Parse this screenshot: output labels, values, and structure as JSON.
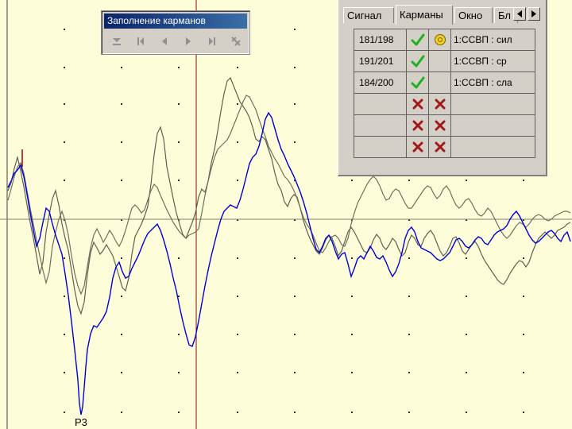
{
  "toolbar": {
    "title": "Заполнение карманов",
    "buttons": [
      {
        "name": "download-icon"
      },
      {
        "name": "first-icon"
      },
      {
        "name": "prev-icon"
      },
      {
        "name": "next-icon"
      },
      {
        "name": "last-icon"
      },
      {
        "name": "auto-fill-icon"
      }
    ]
  },
  "panel": {
    "tabs": [
      "Сигнал",
      "Карманы",
      "Окно",
      "Бл"
    ],
    "active_tab": "Карманы",
    "rows": [
      {
        "count": "181/198",
        "accepted": true,
        "selected": true,
        "label": "1:ССВП : сил"
      },
      {
        "count": "191/201",
        "accepted": true,
        "selected": false,
        "label": "1:ССВП : ср"
      },
      {
        "count": "184/200",
        "accepted": true,
        "selected": false,
        "label": "1:ССВП : сла"
      },
      {
        "count": "",
        "accepted": false,
        "selected": false,
        "label": ""
      },
      {
        "count": "",
        "accepted": false,
        "selected": false,
        "label": ""
      },
      {
        "count": "",
        "accepted": false,
        "selected": false,
        "label": ""
      }
    ]
  },
  "plot": {
    "peak_label": "P3",
    "colors": {
      "background": "#fdfdd9",
      "grey_trace_1": "#606050",
      "grey_trace_2": "#707060",
      "blue_trace": "#0000dd",
      "cursor_line": "#a00000",
      "baseline": "#808070",
      "grid_dot": "#303030"
    }
  }
}
